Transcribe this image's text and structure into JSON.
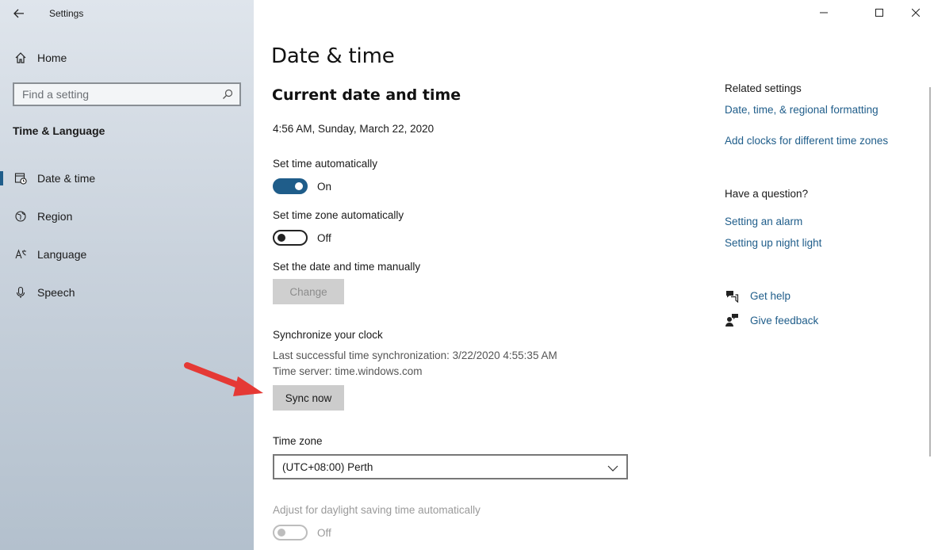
{
  "window": {
    "app_title": "Settings"
  },
  "sidebar": {
    "home_label": "Home",
    "search_placeholder": "Find a setting",
    "section": "Time & Language",
    "items": [
      {
        "label": "Date & time",
        "icon": "calendar-clock-icon",
        "active": true
      },
      {
        "label": "Region",
        "icon": "globe-icon",
        "active": false
      },
      {
        "label": "Language",
        "icon": "language-icon",
        "active": false
      },
      {
        "label": "Speech",
        "icon": "microphone-icon",
        "active": false
      }
    ]
  },
  "main": {
    "title": "Date & time",
    "current_heading": "Current date and time",
    "current_value": "4:56 AM, Sunday, March 22, 2020",
    "set_time_auto": {
      "label": "Set time automatically",
      "state": "On"
    },
    "set_timezone_auto": {
      "label": "Set time zone automatically",
      "state": "Off"
    },
    "manual": {
      "label": "Set the date and time manually",
      "button": "Change"
    },
    "sync": {
      "heading": "Synchronize your clock",
      "last_sync": "Last successful time synchronization: 3/22/2020 4:55:35 AM",
      "server": "Time server: time.windows.com",
      "button": "Sync now"
    },
    "timezone": {
      "label": "Time zone",
      "value": "(UTC+08:00) Perth"
    },
    "dst": {
      "label": "Adjust for daylight saving time automatically",
      "state": "Off"
    }
  },
  "related": {
    "heading": "Related settings",
    "links": [
      "Date, time, & regional formatting",
      "Add clocks for different time zones"
    ]
  },
  "question": {
    "heading": "Have a question?",
    "links": [
      "Setting an alarm",
      "Setting up night light"
    ]
  },
  "help": {
    "get_help": "Get help",
    "give_feedback": "Give feedback"
  },
  "colors": {
    "accent": "#1f5d8a",
    "annotation_arrow": "#e53935"
  }
}
